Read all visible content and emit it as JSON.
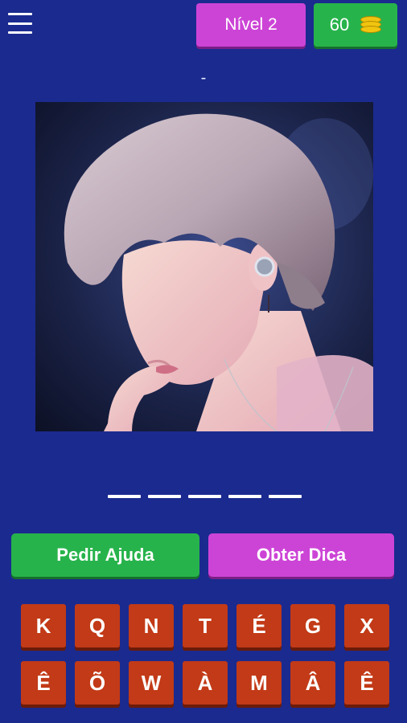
{
  "header": {
    "menu_icon": "hamburger-menu-icon",
    "level_label": "Nível 2",
    "coins": "60",
    "coins_icon": "coin-stack-icon"
  },
  "question": {
    "revealed_hint": "-",
    "image_description": "photo of a performer with light ash hair and an in-ear monitor",
    "answer_slots": 5
  },
  "actions": {
    "help_label": "Pedir Ajuda",
    "hint_label": "Obter Dica"
  },
  "keyboard": {
    "row1": [
      "K",
      "Q",
      "N",
      "T",
      "É",
      "G",
      "X"
    ],
    "row2": [
      "Ê",
      "Õ",
      "W",
      "À",
      "M",
      "Â",
      "Ê"
    ]
  },
  "colors": {
    "background": "#1b2a8f",
    "level_badge": "#cc44d6",
    "coins_badge": "#27b34b",
    "key": "#c23a17",
    "help_button": "#27b34b",
    "hint_button": "#cc44d6"
  }
}
